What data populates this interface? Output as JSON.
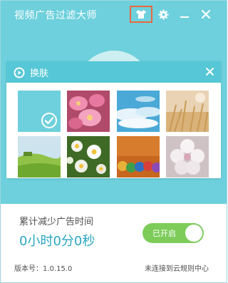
{
  "app": {
    "title": "视频广告过滤大师",
    "icons": [
      "tshirt-icon",
      "gear-icon",
      "minimize-icon",
      "close-icon"
    ]
  },
  "skin_panel": {
    "title": "换肤",
    "icons": [
      "refresh-icon",
      "close-icon"
    ],
    "thumbnails": [
      {
        "name": "default-teal",
        "selected": true
      },
      {
        "name": "pink-flowers",
        "selected": false
      },
      {
        "name": "blue-sky-clouds",
        "selected": false
      },
      {
        "name": "golden-grass",
        "selected": false
      },
      {
        "name": "green-field",
        "selected": false
      },
      {
        "name": "white-daisies",
        "selected": false
      },
      {
        "name": "colored-pencils",
        "selected": false
      },
      {
        "name": "white-blossom",
        "selected": false
      }
    ]
  },
  "stats": {
    "label": "累计减少广告时间",
    "value": "0小时0分0秒"
  },
  "toggle": {
    "label": "已开启",
    "on": true
  },
  "footer": {
    "version": "版本号：1.0.15.0",
    "cloud_status": "未连接到云规则中心"
  },
  "colors": {
    "header": "#6dd0dc",
    "panel_header": "#56c7d6",
    "accent_text": "#2aa7bf",
    "toggle_on": "#7dcc5a",
    "highlight_border": "#e8693d"
  }
}
